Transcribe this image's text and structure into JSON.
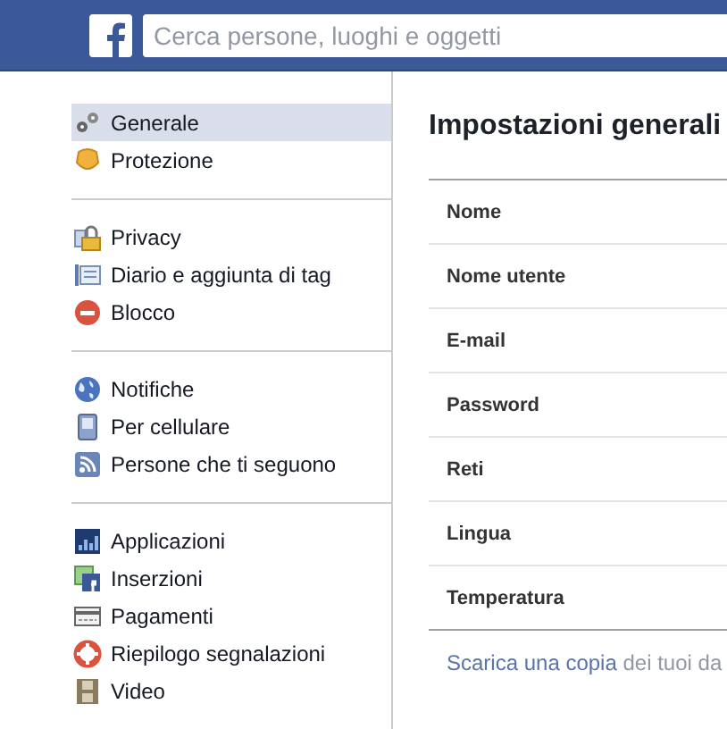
{
  "topbar": {
    "search": {
      "placeholder": "Cerca persone, luoghi e oggetti"
    }
  },
  "sidebar": {
    "groups": [
      {
        "items": [
          {
            "label": "Generale",
            "selected": true
          },
          {
            "label": "Protezione",
            "selected": false
          }
        ]
      },
      {
        "items": [
          {
            "label": "Privacy",
            "selected": false
          },
          {
            "label": "Diario e aggiunta di tag",
            "selected": false
          },
          {
            "label": "Blocco",
            "selected": false
          }
        ]
      },
      {
        "items": [
          {
            "label": "Notifiche",
            "selected": false
          },
          {
            "label": "Per cellulare",
            "selected": false
          },
          {
            "label": "Persone che ti seguono",
            "selected": false
          }
        ]
      },
      {
        "items": [
          {
            "label": "Applicazioni",
            "selected": false
          },
          {
            "label": "Inserzioni",
            "selected": false
          },
          {
            "label": "Pagamenti",
            "selected": false
          },
          {
            "label": "Riepilogo segnalazioni",
            "selected": false
          },
          {
            "label": "Video",
            "selected": false
          }
        ]
      }
    ]
  },
  "content": {
    "title": "Impostazioni generali",
    "rows": [
      {
        "label": "Nome"
      },
      {
        "label": "Nome utente"
      },
      {
        "label": "E-mail"
      },
      {
        "label": "Password"
      },
      {
        "label": "Reti"
      },
      {
        "label": "Lingua"
      },
      {
        "label": "Temperatura"
      }
    ],
    "footer": {
      "link": "Scarica una copia",
      "text": "dei tuoi da"
    }
  }
}
